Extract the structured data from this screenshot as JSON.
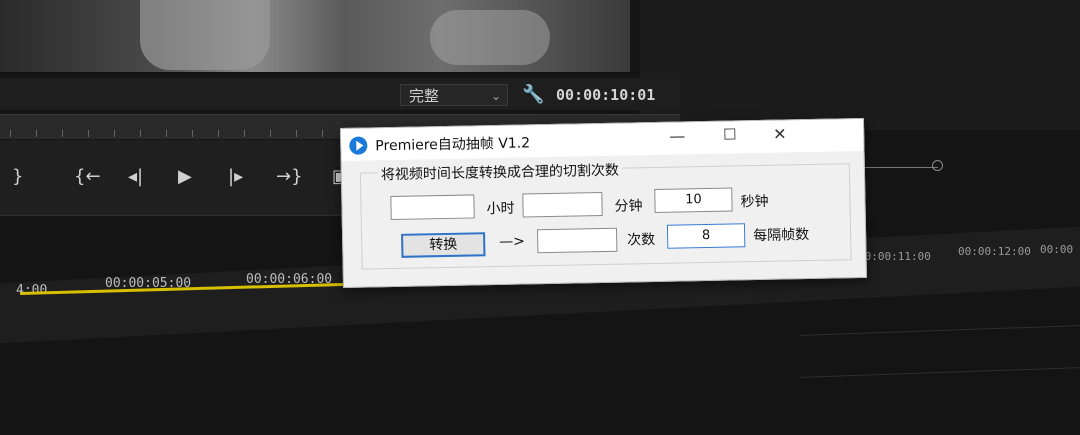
{
  "monitor": {
    "zoom": "完整",
    "timecode": "00:00:10:01"
  },
  "timeline": {
    "timecodes": [
      "4:00",
      "00:00:05:00",
      "00:00:06:00",
      "00:00:11:00",
      "00:00:12:00",
      "00:00"
    ]
  },
  "dialog": {
    "title": "Premiere自动抽帧 V1.2",
    "group_label": "将视频时间长度转换成合理的切割次数",
    "hour_value": "",
    "hour_label": "小时",
    "minute_value": "",
    "minute_label": "分钟",
    "second_value": "10",
    "second_label": "秒钟",
    "convert_label": "转换",
    "arrow": "—>",
    "result_value": "",
    "count_label": "次数",
    "interval_value": "8",
    "interval_label": "每隔帧数"
  },
  "icons": [
    "wrench-icon",
    "app-icon",
    "minimize-icon",
    "maximize-icon",
    "close-icon",
    "play-icon"
  ]
}
